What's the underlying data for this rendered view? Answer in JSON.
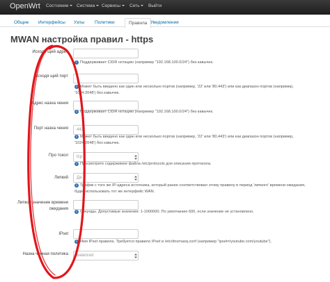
{
  "nav": {
    "brand": "OpenWrt",
    "items": [
      "Состояние",
      "Система",
      "Сервисы",
      "Сеть",
      "Выйти"
    ]
  },
  "tabs": [
    "Общие",
    "Интерфейсы",
    "Узлы",
    "Политики",
    "Правила",
    "Уведомления"
  ],
  "active_tab_index": 4,
  "title": "MWAN настройка правил - https",
  "rows": [
    {
      "label": "Исходя щий адрес",
      "value": "",
      "hint": "Поддерживает CIDR нотацию (например \"192.168.100.0/24\") без кавычек."
    },
    {
      "label": "Исходя щий порт",
      "value": "",
      "hint": "Может быть введено как один или несколько портов (например, '22' или '80,443') или как диапазон портов (например, '1024:2048') без кавычек."
    },
    {
      "label": "Адрес назна чения",
      "value": "",
      "hint": "Поддерживает CIDR нотацию (например \"192.168.100.0/24\") без кавычек."
    },
    {
      "label": "Порт назна чения",
      "value": "443",
      "hint": "Может быть введено как один или несколько портов (например, '22' или '80,443') или как диапазон портов (например, '1024:2048') без кавычек."
    },
    {
      "label": "Про токол",
      "value": "tcp",
      "hint": "Просмотрите содержимое файла /etc/protocols для описания протокола."
    },
    {
      "label": "Липкий",
      "value": "Да",
      "hint": "Трафик с того же IP-адреса источника, который ранее соответствовал этому правилу в период 'липкого' времени ожидания, будет использовать тот же интерфейс WAN."
    },
    {
      "label": "Липкое значение времени ожидания",
      "value": "",
      "hint": "Секунды. Допустимые значения: 1-1000000. По умолчанию 600, если значение не установлено."
    },
    {
      "label": "IPset",
      "value": "",
      "hint": "Имя IPset правила. Требуется правило IPset в /etc/dnsmasq.conf (например \"ipset=/youtube.com/youtube\")."
    },
    {
      "label": "Назна ченная политика",
      "value": "balanced",
      "hint": ""
    }
  ],
  "colors": {
    "annotation": "#e0161b",
    "link": "#0069a6",
    "info_icon": "#2c6fb8"
  }
}
